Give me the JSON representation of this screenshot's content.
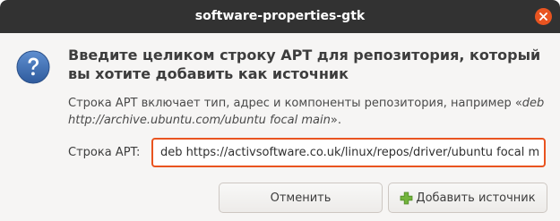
{
  "window": {
    "title": "software-properties-gtk"
  },
  "dialog": {
    "heading": "Введите целиком строку APT для репозитория, который вы хотите добавить как источник",
    "description_prefix": "Строка APT включает тип, адрес и компоненты репозитория, например «",
    "description_example": "deb http://archive.ubuntu.com/ubuntu focal main",
    "description_suffix": "».",
    "field_label": "Строка APT:",
    "apt_line_value": "deb https://activsoftware.co.uk/linux/repos/driver/ubuntu focal main"
  },
  "buttons": {
    "cancel_label": "Отменить",
    "add_label": "Добавить источник"
  },
  "icons": {
    "close": "close-icon",
    "question": "question-icon",
    "add": "add-icon"
  },
  "colors": {
    "titlebar": "#323232",
    "accent": "#e95420",
    "question_icon": "#3f6fb4",
    "add_icon": "#73b43c"
  }
}
